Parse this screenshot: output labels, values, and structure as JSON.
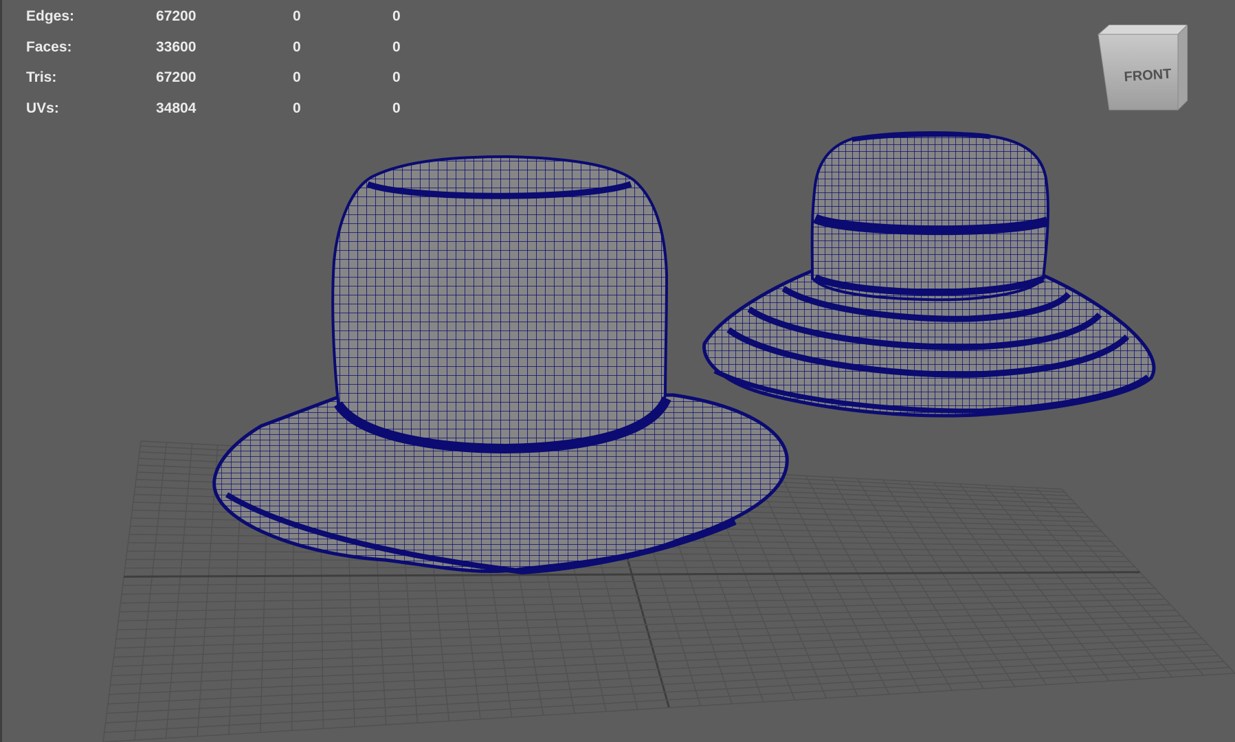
{
  "hud": {
    "rows": [
      {
        "label": "Edges:",
        "v1": "67200",
        "v2": "0",
        "v3": "0"
      },
      {
        "label": "Faces:",
        "v1": "33600",
        "v2": "0",
        "v3": "0"
      },
      {
        "label": "Tris:",
        "v1": "67200",
        "v2": "0",
        "v3": "0"
      },
      {
        "label": "UVs:",
        "v1": "34804",
        "v2": "0",
        "v3": "0"
      }
    ]
  },
  "viewcube": {
    "label": "FRONT"
  },
  "colors": {
    "viewport_bg": "#5d5d5d",
    "grid": "#505050",
    "grid_axis": "#3e3e3e",
    "wire": "#0b0b72",
    "mesh_fill": "#858585",
    "hud_text": "#ececec"
  },
  "icons": {
    "viewcube": "view-cube-icon"
  }
}
